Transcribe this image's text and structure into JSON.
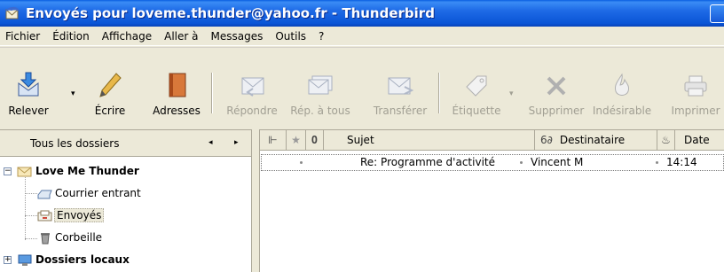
{
  "window": {
    "title": "Envoyés pour loveme.thunder@yahoo.fr - Thunderbird"
  },
  "menubar": {
    "items": [
      "Fichier",
      "Édition",
      "Affichage",
      "Aller à",
      "Messages",
      "Outils",
      "?"
    ]
  },
  "toolbar": {
    "relever": "Relever",
    "ecrire": "Écrire",
    "adresses": "Adresses",
    "repondre": "Répondre",
    "rep_a_tous": "Rép. à tous",
    "transferer": "Transférer",
    "etiquette": "Étiquette",
    "supprimer": "Supprimer",
    "indesirable": "Indésirable",
    "imprimer": "Imprimer"
  },
  "folder_pane": {
    "header": "Tous les dossiers",
    "nav_left": "◂",
    "nav_right": "▸",
    "account": "Love Me Thunder",
    "folders": [
      "Courrier entrant",
      "Envoyés",
      "Corbeille"
    ],
    "local": "Dossiers locaux"
  },
  "message_list": {
    "columns": {
      "subject": "Sujet",
      "recipient": "Destinataire",
      "date": "Date"
    },
    "rows": [
      {
        "subject": "Re: Programme d'activité",
        "recipient": "Vincent M",
        "date": "14:14"
      }
    ]
  }
}
